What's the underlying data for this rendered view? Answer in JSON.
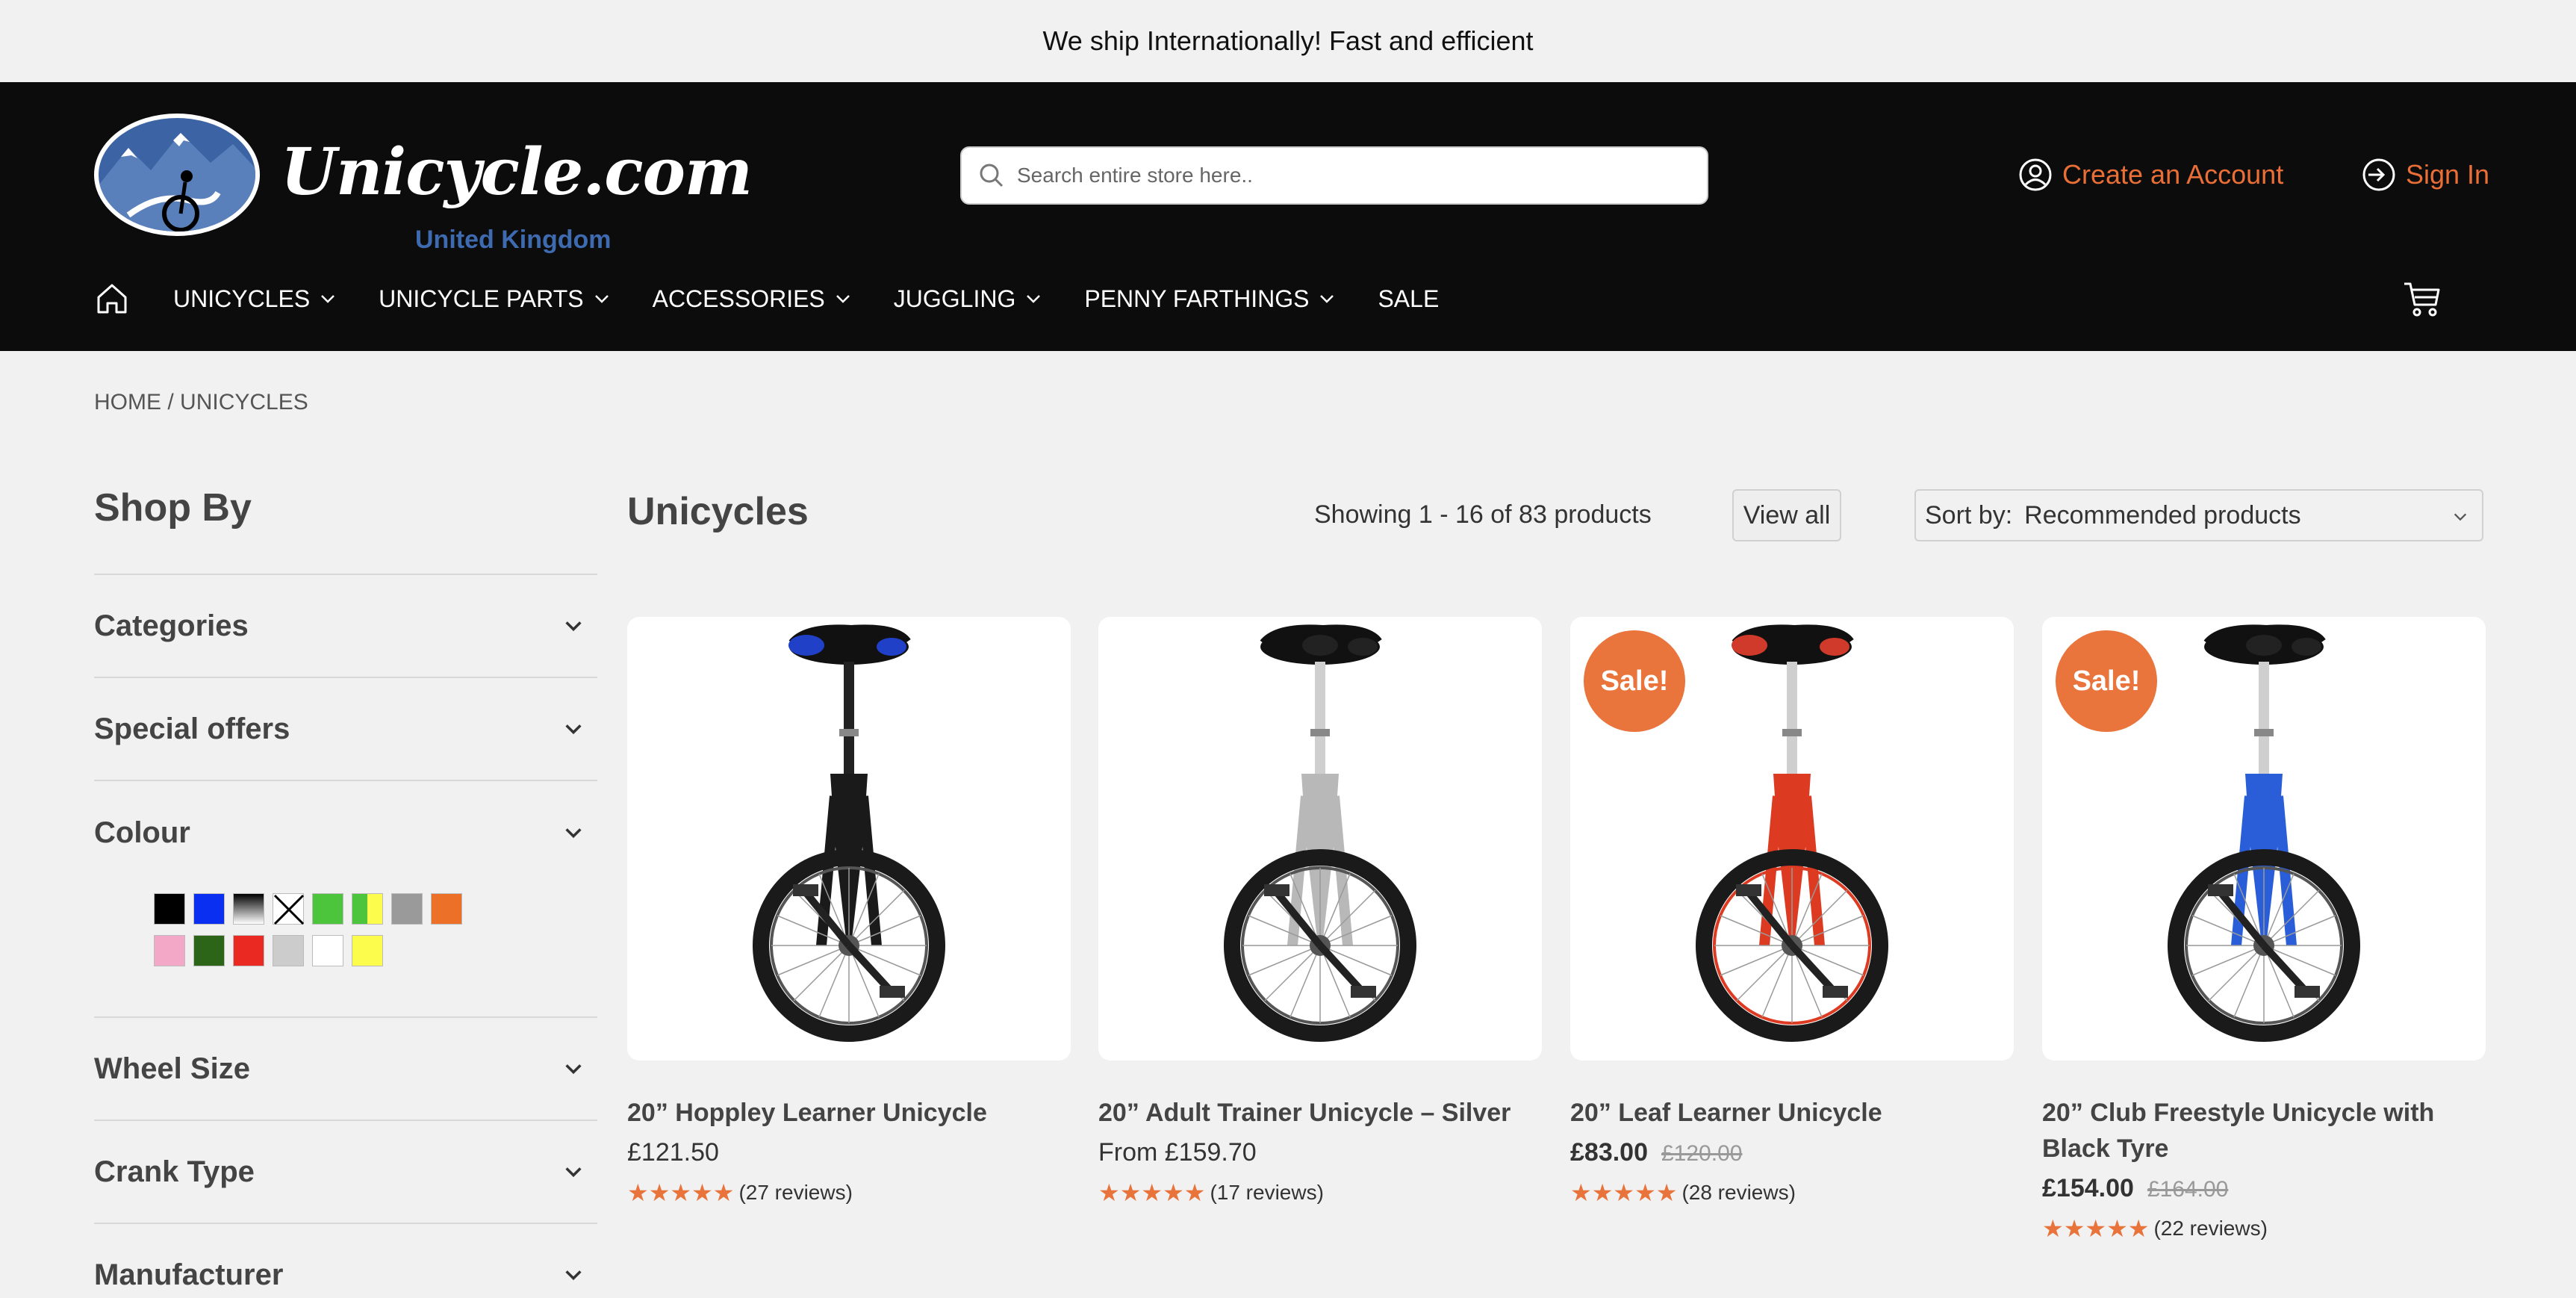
{
  "topbar": {
    "message": "We ship Internationally! Fast and efficient"
  },
  "header": {
    "logo_text": "Unicycle.com",
    "logo_sub": "United Kingdom",
    "search_placeholder": "Search entire store here..",
    "create_account": "Create an Account",
    "sign_in": "Sign In"
  },
  "nav": {
    "items": [
      {
        "label": "UNICYCLES",
        "has_dropdown": true
      },
      {
        "label": "UNICYCLE PARTS",
        "has_dropdown": true
      },
      {
        "label": "ACCESSORIES",
        "has_dropdown": true
      },
      {
        "label": "JUGGLING",
        "has_dropdown": true
      },
      {
        "label": "PENNY FARTHINGS",
        "has_dropdown": true
      },
      {
        "label": "SALE",
        "has_dropdown": false
      }
    ]
  },
  "breadcrumb": {
    "home": "HOME",
    "separator": "/",
    "current": "UNICYCLES"
  },
  "sidebar": {
    "title": "Shop By",
    "facets": [
      "Categories",
      "Special offers",
      "Colour",
      "Wheel Size",
      "Crank Type",
      "Manufacturer"
    ],
    "colours": [
      "#000000",
      "#0a2ff0",
      "gradient-black-white",
      "x-white",
      "#4cc43c",
      "yellow-green",
      "#9a9a9a",
      "#ec7028",
      "#f4a8c8",
      "#2c6418",
      "#ea2a22",
      "#cccccc",
      "#ffffff",
      "#fcfc4c"
    ]
  },
  "listing": {
    "title": "Unicycles",
    "count_text": "Showing 1 - 16 of 83 products",
    "view_all": "View all",
    "sort_label": "Sort by:",
    "sort_value": "Recommended products"
  },
  "products": [
    {
      "name": "20” Hoppley Learner Unicycle",
      "price": "£121.50",
      "was": "",
      "sale": false,
      "reviews": "(27 reviews)",
      "rating": 5,
      "frame_color": "#1a1a1a",
      "saddle_accent": "#2140c8",
      "wheel_rim": "#555555"
    },
    {
      "name": "20” Adult Trainer Unicycle – Silver",
      "price": "From £159.70",
      "was": "",
      "sale": false,
      "reviews": "(17 reviews)",
      "rating": 5,
      "frame_color": "#b8b8b8",
      "saddle_accent": "#222222",
      "wheel_rim": "#555555"
    },
    {
      "name": "20” Leaf Learner Unicycle",
      "price": "£83.00",
      "was": "£120.00",
      "sale": true,
      "badge": "Sale!",
      "reviews": "(28 reviews)",
      "rating": 5,
      "frame_color": "#dd3a22",
      "saddle_accent": "#d03a2a",
      "wheel_rim": "#dd3a22"
    },
    {
      "name": "20” Club Freestyle Unicycle with Black Tyre",
      "price": "£154.00",
      "was": "£164.00",
      "sale": true,
      "badge": "Sale!",
      "reviews": "(22 reviews)",
      "rating": 5,
      "frame_color": "#2a5ed8",
      "saddle_accent": "#222222",
      "wheel_rim": "#555555"
    }
  ]
}
